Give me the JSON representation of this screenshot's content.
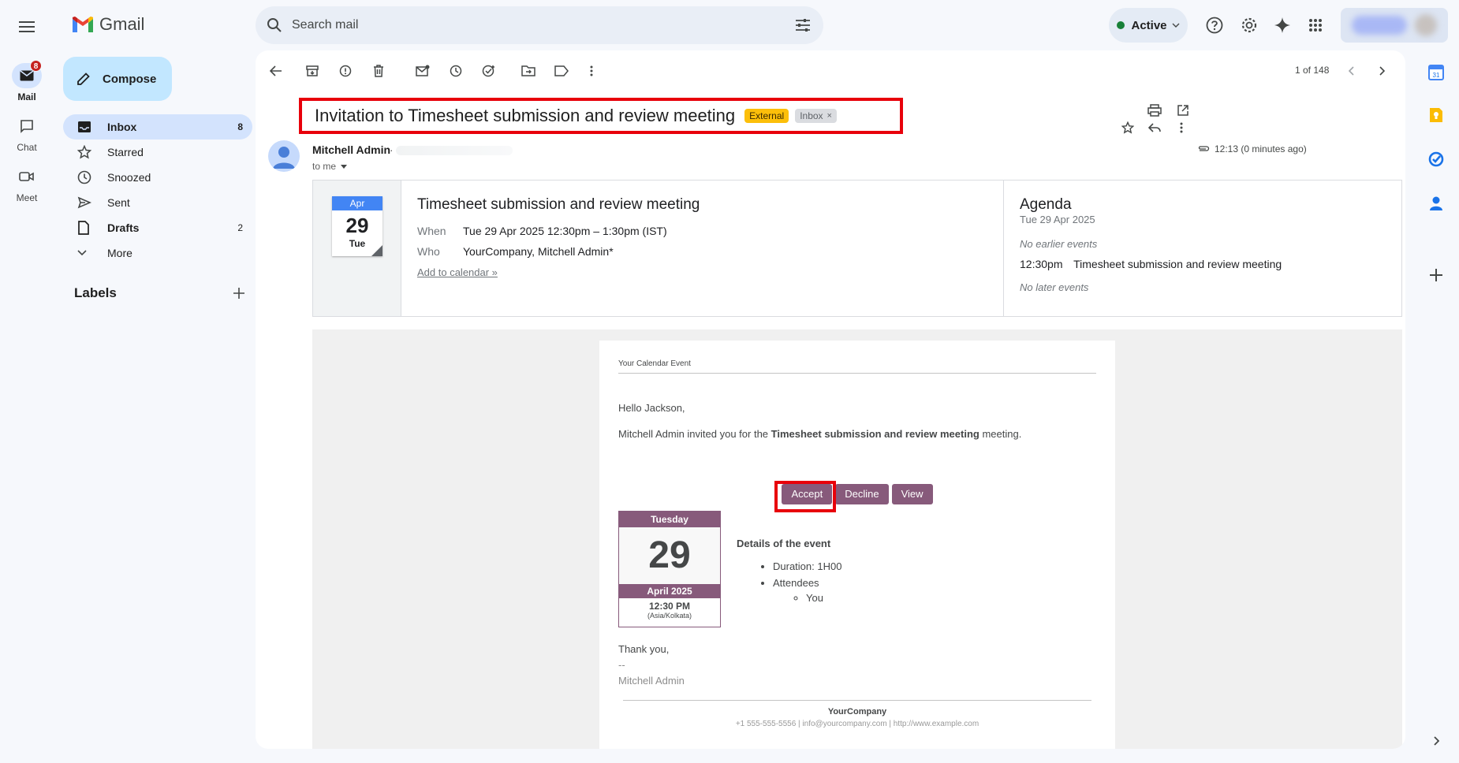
{
  "app": {
    "name": "Gmail"
  },
  "rail": {
    "mail_label": "Mail",
    "mail_badge": "8",
    "chat_label": "Chat",
    "meet_label": "Meet"
  },
  "search": {
    "placeholder": "Search mail"
  },
  "status": {
    "label": "Active"
  },
  "compose": {
    "label": "Compose"
  },
  "nav": {
    "items": [
      {
        "label": "Inbox",
        "count": "8"
      },
      {
        "label": "Starred",
        "count": ""
      },
      {
        "label": "Snoozed",
        "count": ""
      },
      {
        "label": "Sent",
        "count": ""
      },
      {
        "label": "Drafts",
        "count": "2"
      },
      {
        "label": "More",
        "count": ""
      }
    ],
    "labels_header": "Labels"
  },
  "toolbar": {
    "pager": "1 of 148"
  },
  "email": {
    "subject": "Invitation to Timesheet submission and review meeting",
    "tag_external": "External",
    "tag_inbox": "Inbox",
    "tag_inbox_close": "×",
    "sender": "Mitchell Admin",
    "sender_sep": "·",
    "to": "to me",
    "time": "12:13 (0 minutes ago)"
  },
  "calendar_card": {
    "month": "Apr",
    "day": "29",
    "weekday": "Tue",
    "title": "Timesheet submission and review meeting",
    "when_label": "When",
    "when_value": "Tue 29 Apr 2025 12:30pm – 1:30pm (IST)",
    "who_label": "Who",
    "who_value": "YourCompany, Mitchell Admin*",
    "add_link": "Add to calendar »",
    "agenda_title": "Agenda",
    "agenda_date": "Tue 29 Apr 2025",
    "no_earlier": "No earlier events",
    "event_time": "12:30pm",
    "event_title": "Timesheet submission and review meeting",
    "no_later": "No later events"
  },
  "body": {
    "kicker": "Your Calendar Event",
    "greeting": "Hello Jackson,",
    "invite_prefix": "Mitchell Admin invited you for the ",
    "invite_bold": "Timesheet submission and review meeting",
    "invite_suffix": " meeting.",
    "accept": "Accept",
    "decline": "Decline",
    "view": "View",
    "cal_weekday": "Tuesday",
    "cal_day": "29",
    "cal_month": "April 2025",
    "cal_time": "12:30 PM",
    "cal_tz": "(Asia/Kolkata)",
    "details_title": "Details of the event",
    "duration": "Duration: 1H00",
    "attendees": "Attendees",
    "attendee_you": "You",
    "thanks": "Thank you,",
    "dashes": "--",
    "signature": "Mitchell Admin",
    "company": "YourCompany",
    "contact": "+1 555-555-5556 | info@yourcompany.com | http://www.example.com"
  },
  "colors": {
    "accent": "#875a7b",
    "highlight": "#e8000b",
    "brand_blue": "#0b57d0"
  }
}
